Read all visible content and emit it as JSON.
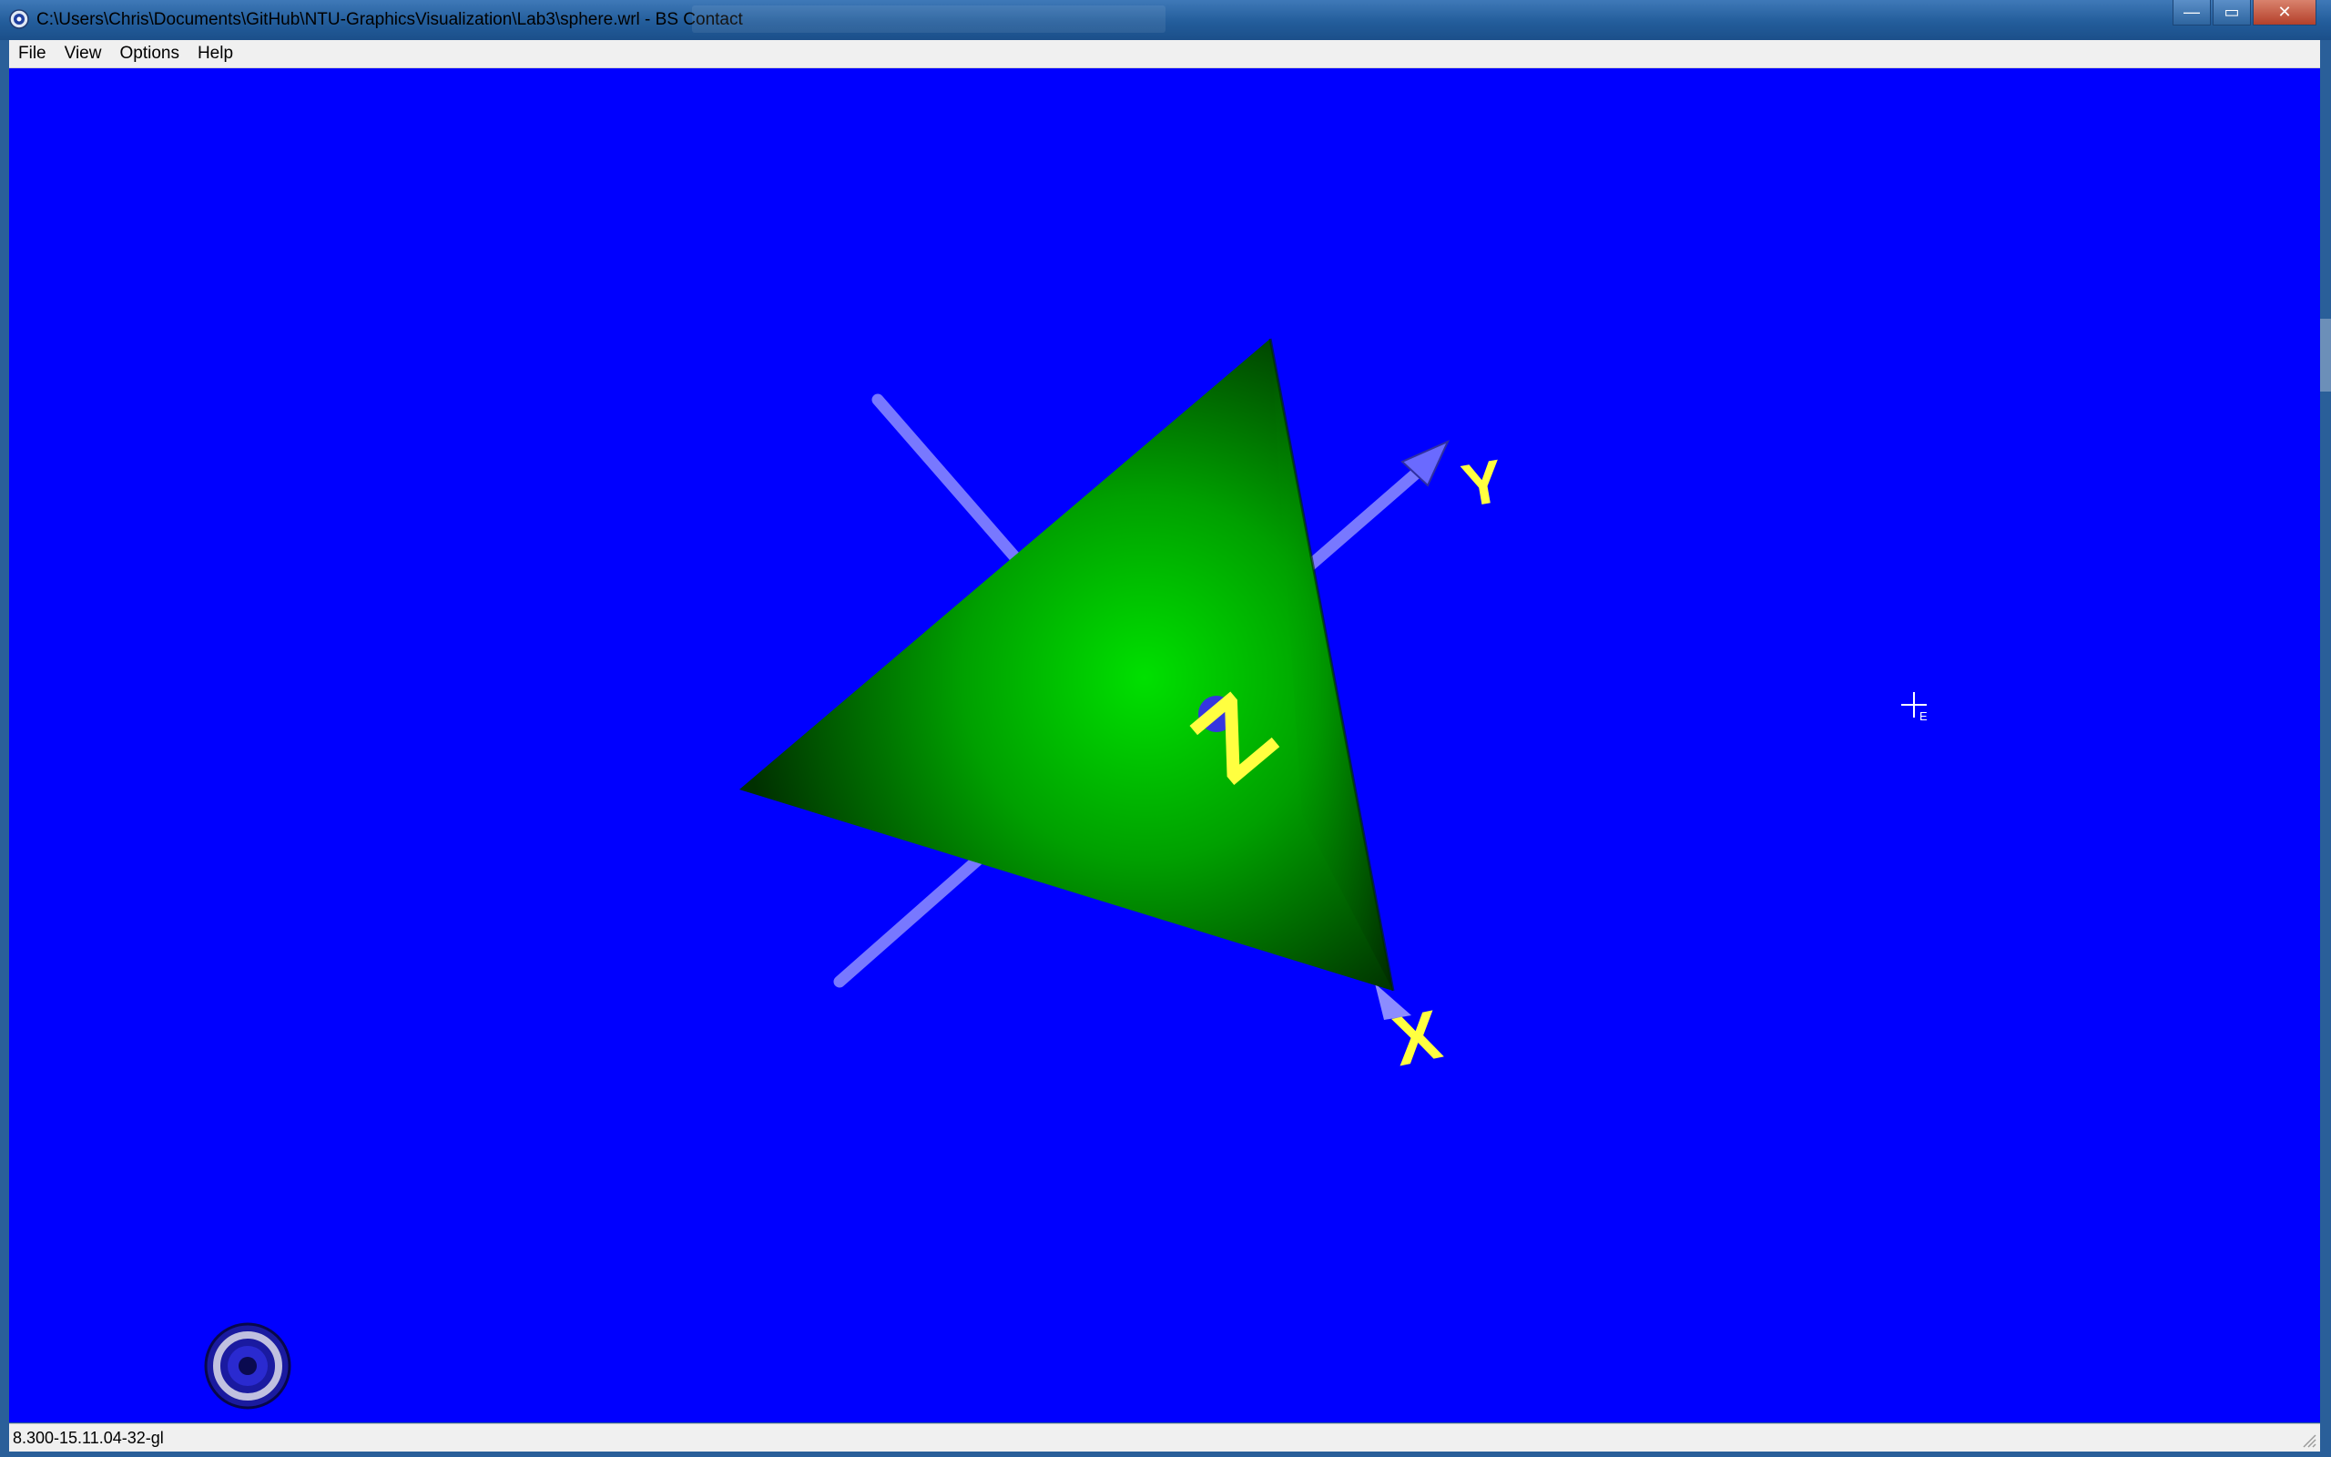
{
  "window": {
    "title": "C:\\Users\\Chris\\Documents\\GitHub\\NTU-GraphicsVisualization\\Lab3\\sphere.wrl - BS Contact",
    "app_icon": "bs-contact-icon",
    "controls": {
      "minimize": "—",
      "maximize": "▭",
      "close": "✕"
    }
  },
  "menu": {
    "items": [
      {
        "label": "File"
      },
      {
        "label": "View"
      },
      {
        "label": "Options"
      },
      {
        "label": "Help"
      }
    ]
  },
  "scene": {
    "background": "#0000ff",
    "object": "green-tetrahedron",
    "object_color": "#00aa00",
    "axis_color": "#8080ff",
    "label_color": "#ffff40",
    "axis_labels": {
      "x": "X",
      "y": "Y",
      "z": "Z"
    }
  },
  "status": {
    "text": "8.300-15.11.04-32-gl"
  }
}
